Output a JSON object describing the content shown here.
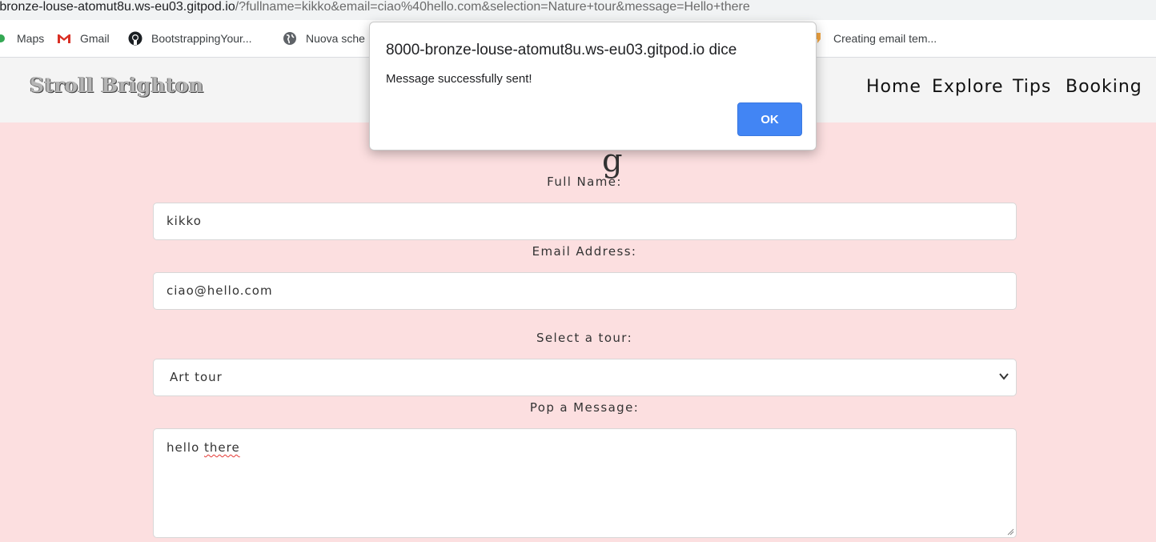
{
  "browser": {
    "url_host": "-bronze-louse-atomut8u.ws-eu03.gitpod.io",
    "url_rest": "/?fullname=kikko&email=ciao%40hello.com&selection=Nature+tour&message=Hello+there",
    "bookmarks": [
      {
        "label": "Maps",
        "icon": "maps-icon"
      },
      {
        "label": "Gmail",
        "icon": "gmail-icon"
      },
      {
        "label": "BootstrappingYour...",
        "icon": "github-icon"
      },
      {
        "label": "Nuova sche",
        "icon": "globe-icon"
      },
      {
        "label": "Creating email tem...",
        "icon": "bookmark-icon"
      }
    ]
  },
  "site": {
    "brand": "Stroll Brighton",
    "nav": [
      "Home",
      "Explore",
      "Tips",
      "Booking"
    ]
  },
  "form": {
    "heading_partial": "g",
    "full_name_label": "Full Name:",
    "full_name_value": "kikko",
    "email_label": "Email Address:",
    "email_value": "ciao@hello.com",
    "tour_label": "Select a tour:",
    "tour_value": "Art tour",
    "message_label": "Pop a Message:",
    "message_word1": "hello",
    "message_word2": "there"
  },
  "dialog": {
    "title": "8000-bronze-louse-atomut8u.ws-eu03.gitpod.io dice",
    "message": "Message successfully sent!",
    "ok_label": "OK"
  },
  "colors": {
    "page_background": "#fcdfe0",
    "header_background": "#f4f4f4",
    "ok_button": "#4285f4"
  }
}
